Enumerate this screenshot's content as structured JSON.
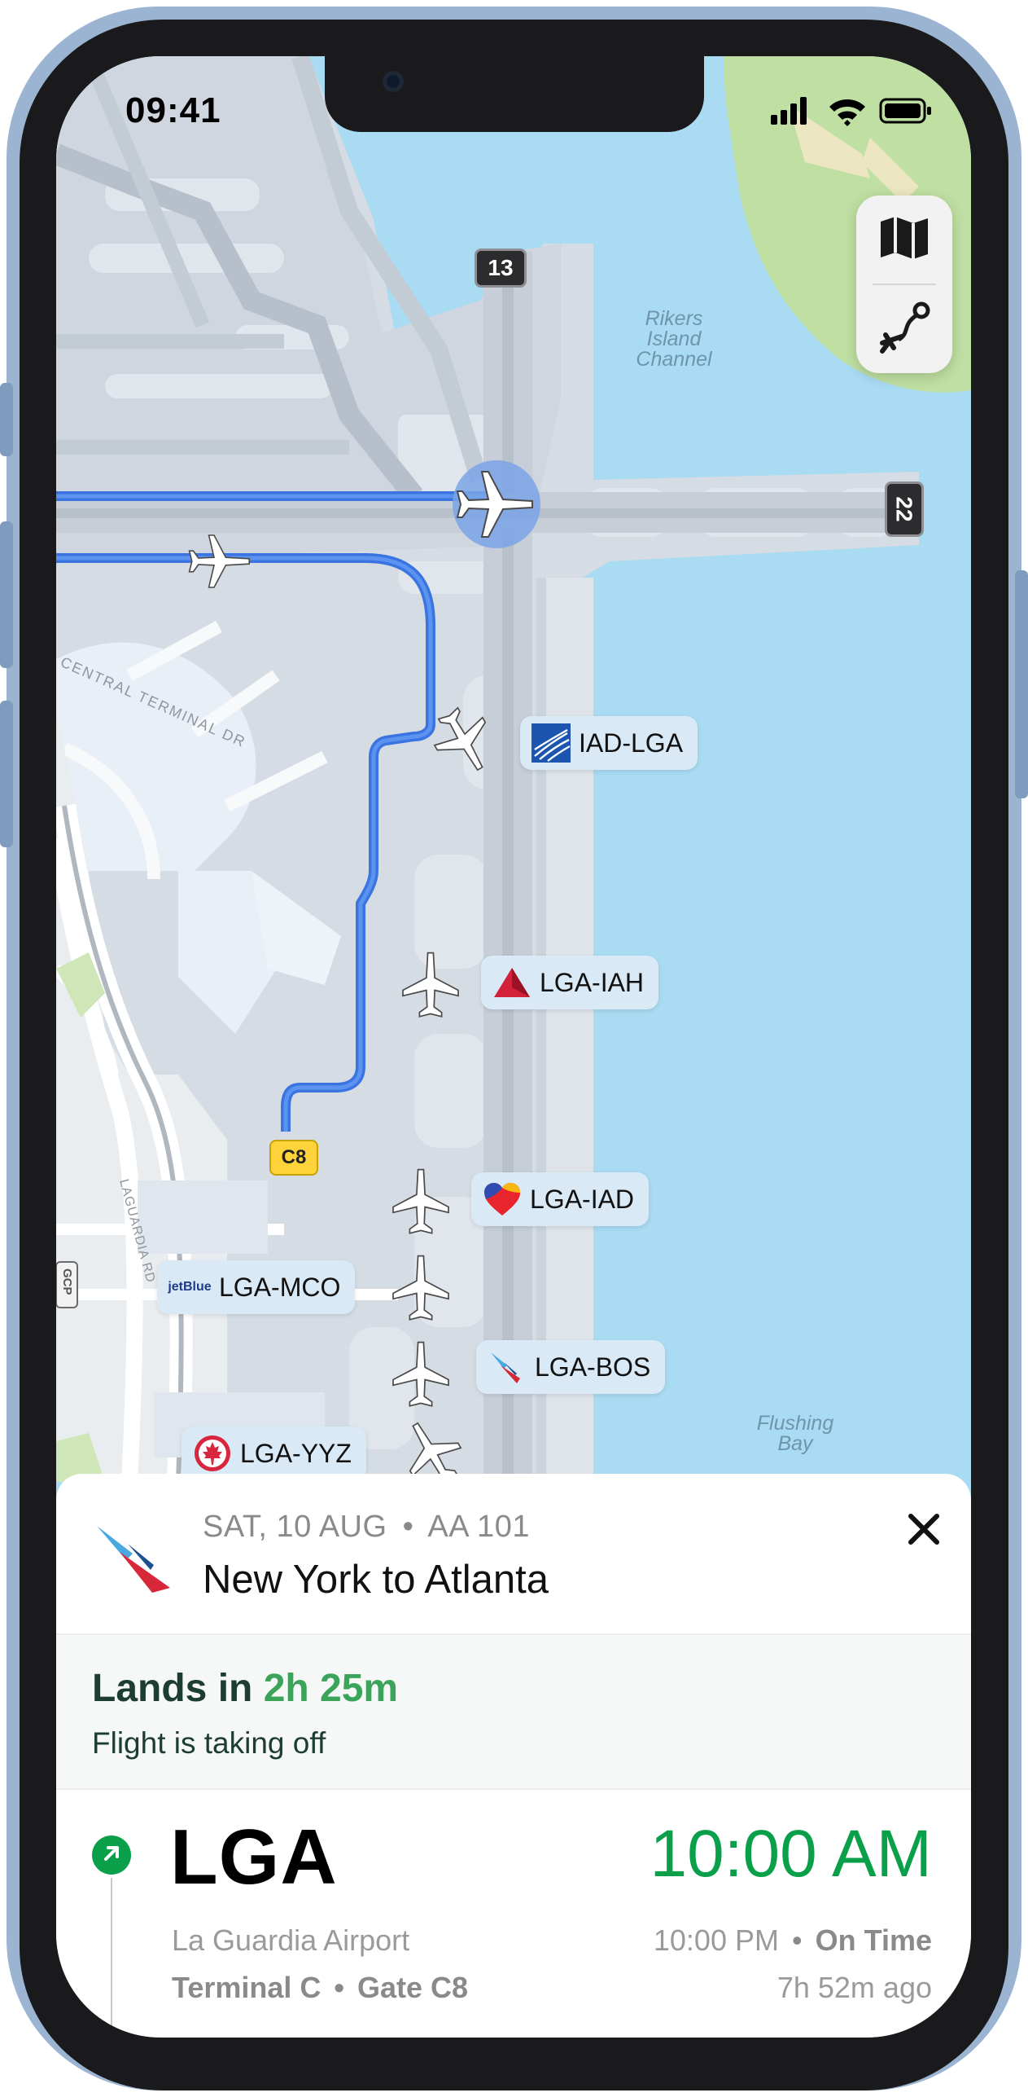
{
  "status_bar": {
    "time": "09:41"
  },
  "map": {
    "runway_13": "13",
    "runway_22": "22",
    "gate": "C8",
    "water_labels": {
      "rikers": "Rikers Island Channel",
      "flushing": "Flushing Bay"
    },
    "road_labels": {
      "central_terminal": "CENTRAL TERMINAL DR",
      "laguardia_rd": "LAGUARDIA RD",
      "gcp": "GCP"
    },
    "flights": [
      {
        "label": "IAD-LGA",
        "airline_icon": "united-logo-icon"
      },
      {
        "label": "LGA-IAH",
        "airline_icon": "delta-logo-icon"
      },
      {
        "label": "LGA-IAD",
        "airline_icon": "southwest-logo-icon"
      },
      {
        "label": "LGA-MCO",
        "airline_icon": "jetblue-logo-icon",
        "logo_text": "jetBlue"
      },
      {
        "label": "LGA-BOS",
        "airline_icon": "american-logo-icon"
      },
      {
        "label": "LGA-YYZ",
        "airline_icon": "aircanada-logo-icon"
      }
    ],
    "controls": [
      "map-icon",
      "route-icon"
    ],
    "colors": {
      "route": "#3a74e0",
      "water": "#a9dbf2",
      "gate_badge": "#ffd43b"
    }
  },
  "sheet": {
    "date": "SAT, 10 AUG",
    "flight_number": "AA 101",
    "route": "New York to Atlanta",
    "lands_in_prefix": "Lands in",
    "lands_in_duration": "2h 25m",
    "status_text": "Flight is taking off",
    "departure": {
      "code": "LGA",
      "airport": "La Guardia Airport",
      "terminal": "Terminal C",
      "gate": "Gate C8",
      "actual_time": "10:00 AM",
      "scheduled_time": "10:00 PM",
      "status": "On Time",
      "ago": "7h 52m ago"
    },
    "colors": {
      "accent_green": "#0aa04a",
      "duration_green": "#3ba35a"
    }
  }
}
